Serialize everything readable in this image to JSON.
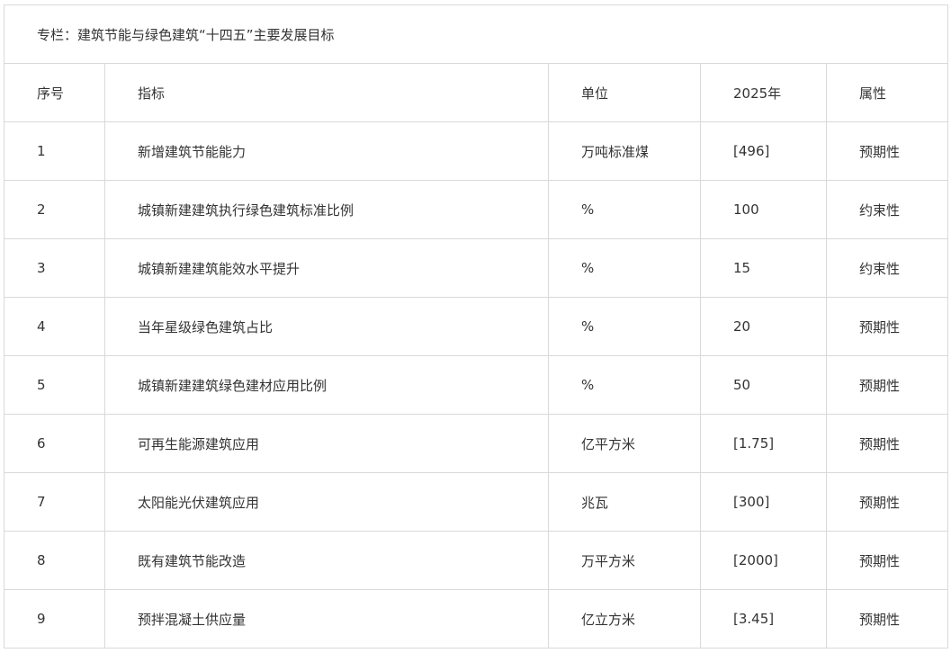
{
  "caption": "专栏：建筑节能与绿色建筑“十四五”主要发展目标",
  "headers": {
    "index": "序号",
    "indicator": "指标",
    "unit": "单位",
    "year": "2025年",
    "attribute": "属性"
  },
  "rows": [
    {
      "index": "1",
      "indicator": "新增建筑节能能力",
      "unit": "万吨标准煤",
      "value": "[496]",
      "attribute": "预期性"
    },
    {
      "index": "2",
      "indicator": "城镇新建建筑执行绿色建筑标准比例",
      "unit": "%",
      "value": "100",
      "attribute": "约束性"
    },
    {
      "index": "3",
      "indicator": "城镇新建建筑能效水平提升",
      "unit": "%",
      "value": "15",
      "attribute": "约束性"
    },
    {
      "index": "4",
      "indicator": "当年星级绿色建筑占比",
      "unit": "%",
      "value": "20",
      "attribute": "预期性"
    },
    {
      "index": "5",
      "indicator": "城镇新建建筑绿色建材应用比例",
      "unit": "%",
      "value": "50",
      "attribute": "预期性"
    },
    {
      "index": "6",
      "indicator": "可再生能源建筑应用",
      "unit": "亿平方米",
      "value": "[1.75]",
      "attribute": "预期性"
    },
    {
      "index": "7",
      "indicator": "太阳能光伏建筑应用",
      "unit": "兆瓦",
      "value": "[300]",
      "attribute": "预期性"
    },
    {
      "index": "8",
      "indicator": "既有建筑节能改造",
      "unit": "万平方米",
      "value": "[2000]",
      "attribute": "预期性"
    },
    {
      "index": "9",
      "indicator": "预拌混凝土供应量",
      "unit": "亿立方米",
      "value": "[3.45]",
      "attribute": "预期性"
    }
  ]
}
